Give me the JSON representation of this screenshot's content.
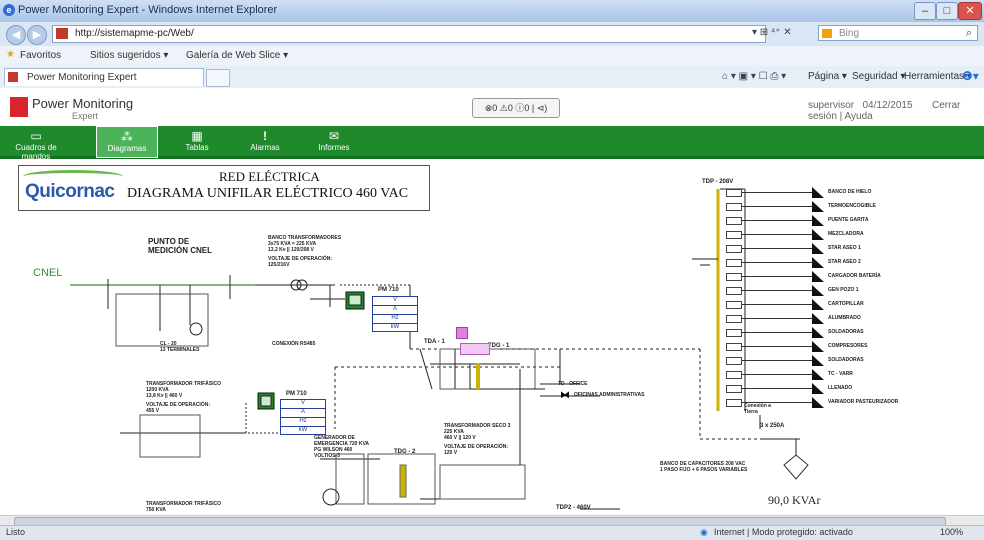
{
  "window": {
    "title": "Power Monitoring Expert - Windows Internet Explorer"
  },
  "address": {
    "url": "http://sistemapme-pc/Web/",
    "search_placeholder": "Bing"
  },
  "favorites": {
    "label": "Favoritos",
    "items": [
      "Sitios sugeridos ▾",
      "Galería de Web Slice ▾"
    ]
  },
  "tab": {
    "title": "Power Monitoring Expert"
  },
  "command_bar": {
    "items": [
      "Página ▾",
      "Seguridad ▾",
      "Herramientas ▾"
    ]
  },
  "app": {
    "logo_main": "Power Monitoring",
    "logo_sub": "Expert",
    "status_icons": "⊗0 ⚠0 ⓘ0 | ⊲)",
    "user": "supervisor",
    "date": "04/12/2015",
    "logout": "Cerrar sesión",
    "help": "Ayuda"
  },
  "nav": {
    "items": [
      {
        "label": "Cuadros de mandos",
        "icon": "dashboard-icon",
        "glyph": "▭"
      },
      {
        "label": "Diagramas",
        "icon": "diagram-icon",
        "glyph": "⁂"
      },
      {
        "label": "Tablas",
        "icon": "table-icon",
        "glyph": "▦"
      },
      {
        "label": "Alarmas",
        "icon": "alarm-icon",
        "glyph": "!"
      },
      {
        "label": "Informes",
        "icon": "report-icon",
        "glyph": "✉"
      }
    ],
    "active": 1
  },
  "diagram": {
    "brand": "Quicornac",
    "title_top": "RED ELÉCTRICA",
    "title_main": "DIAGRAMA UNIFILAR ELÉCTRICO 460 VAC",
    "punto": [
      "PUNTO DE",
      "MEDICIÓN CNEL"
    ],
    "cnel": "CNEL",
    "banco_transformadores": [
      "BANCO TRANSFORMADORES",
      "3x75 KVA = 225 KVA",
      "13,2 Kv || 120/208 V",
      "VOLTAJE DE OPERACIÓN:",
      "125/216V"
    ],
    "pm710_a": "PM 710",
    "meter_rows": [
      "V",
      "A",
      "Hz",
      "kW"
    ],
    "conexion_rs485": "CONEXIÓN RS485",
    "cl_terminales": [
      "CL - 20",
      "13 TERMINALES"
    ],
    "tda": "TDA - 1",
    "tdg1": "TDG - 1",
    "td_office": "TD - OFFICE",
    "oficinas": "OFICINAS ADMINISTRATIVAS",
    "transformador_trifasico": [
      "TRANSFORMADOR TRIFÁSICO",
      "1200 KVA",
      "13,8 Kv || 460 V",
      "VOLTAJE DE OPERACIÓN:",
      "455 V"
    ],
    "pm710_b": "PM 710",
    "generador": [
      "GENERADOR DE",
      "EMERGENCIA 720 KVA",
      "PG WILSON 460",
      "VOLTIOS-3"
    ],
    "tdg2": "TDG - 2",
    "transformador_seco": [
      "TRANSFORMADOR SECO 3",
      "225 KVA",
      "460 V || 120 V",
      "VOLTAJE DE OPERACIÓN:",
      "120 V"
    ],
    "transformador_bottom": [
      "TRANSFORMADOR TRIFÁSICO",
      "750 KVA"
    ],
    "tdp2": "TDP2 - 460V",
    "tdp_208": "TDP - 208V",
    "loads": [
      "BANCO DE HIELO",
      "TERMOENCOGIBLE",
      "PUENTE GARITA",
      "MEZCLADORA",
      "STAR ASEO 1",
      "STAR ASEO 2",
      "CARGADOR BATERÍA",
      "GEN POZO 1",
      "CARTOPILLAR",
      "ALUMBRADO",
      "SOLDADORAS",
      "COMPRESORES",
      "SOLDADORAS",
      "TC - VARR",
      "LLENADO",
      "VARIADOR PASTEURIZADOR"
    ],
    "conexion_tierra": [
      "Conexión a",
      "Tierra"
    ],
    "breaker_3x250": "3 x 250A",
    "banco_capacitores": [
      "BANCO DE CAPACITORES 208 VAC",
      "1 PASO FIJO + 6 PASOS VARIABLES"
    ],
    "kvar": "90,0 KVAr"
  },
  "statusbar": {
    "left": "Listo",
    "zone": "Internet | Modo protegido: activado",
    "zoom": "100%"
  }
}
